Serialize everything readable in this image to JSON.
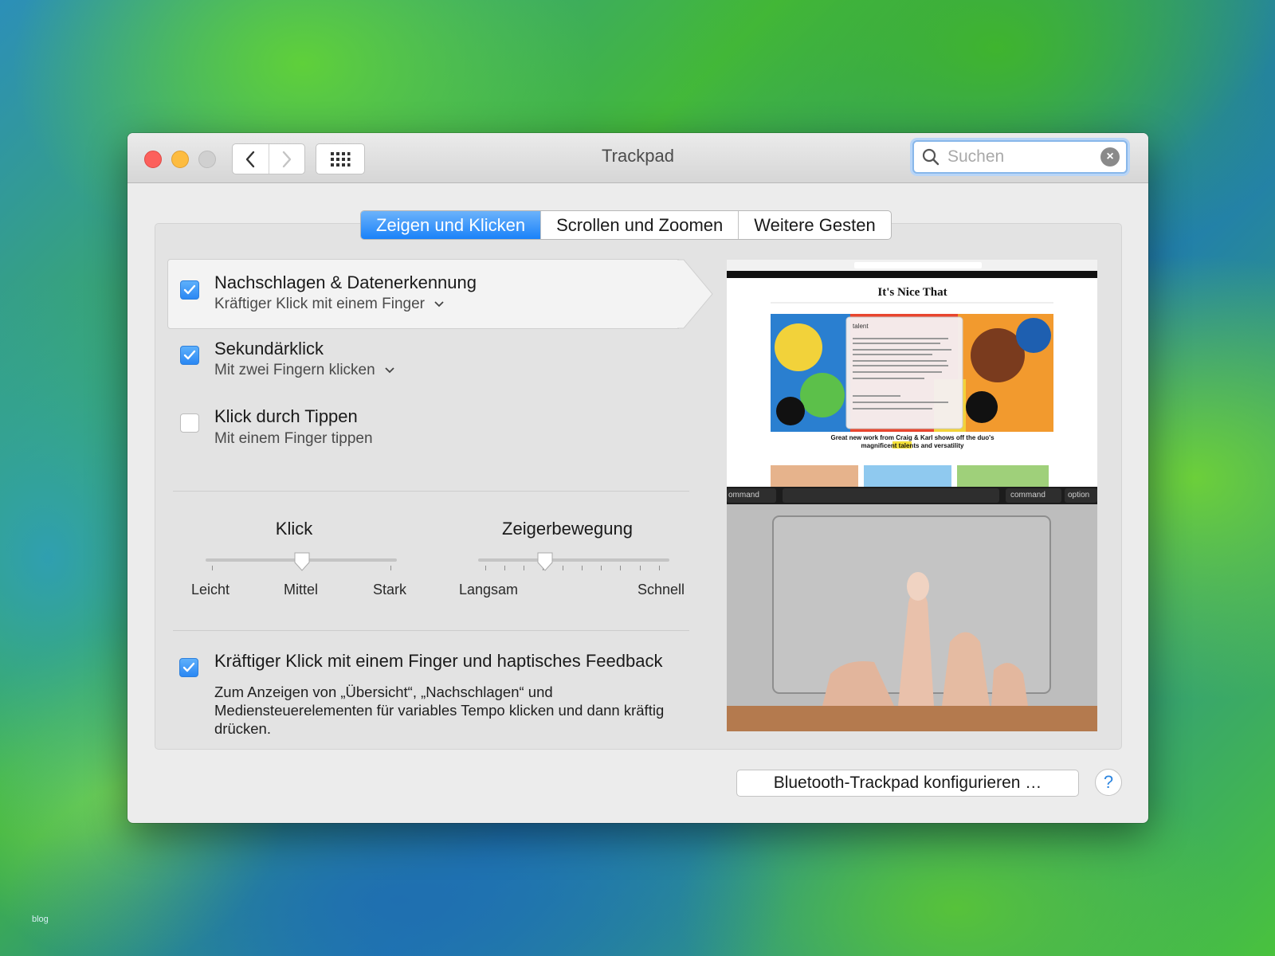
{
  "window": {
    "title": "Trackpad",
    "search_placeholder": "Suchen"
  },
  "tabs": [
    {
      "label": "Zeigen und Klicken",
      "active": true
    },
    {
      "label": "Scrollen und Zoomen",
      "active": false
    },
    {
      "label": "Weitere Gesten",
      "active": false
    }
  ],
  "options": [
    {
      "title": "Nachschlagen & Datenerkennung",
      "subtitle": "Kräftiger Klick mit einem Finger",
      "checked": true,
      "has_dropdown": true
    },
    {
      "title": "Sekundärklick",
      "subtitle": "Mit zwei Fingern klicken",
      "checked": true,
      "has_dropdown": true
    },
    {
      "title": "Klick durch Tippen",
      "subtitle": "Mit einem Finger tippen",
      "checked": false,
      "has_dropdown": false
    }
  ],
  "sliders": {
    "click": {
      "title": "Klick",
      "labels": [
        "Leicht",
        "Mittel",
        "Stark"
      ],
      "value_index": 1,
      "steps": 3
    },
    "tracking": {
      "title": "Zeigerbewegung",
      "min_label": "Langsam",
      "max_label": "Schnell",
      "value_fraction": 0.35,
      "steps": 10
    }
  },
  "force_click": {
    "title": "Kräftiger Klick mit einem Finger und haptisches Feedback",
    "description": "Zum Anzeigen von „Übersicht“, „Nachschlagen“ und Mediensteuerelementen für variables Tempo klicken und dann kräftig drücken.",
    "checked": true
  },
  "preview": {
    "site_name": "It's Nice That",
    "popup_word": "talent",
    "headline_line1": "Great new work from Craig & Karl shows off the duo's",
    "headline_line2": "magnificent talents and versatility",
    "keys": [
      "ommand",
      "command",
      "option"
    ]
  },
  "buttons": {
    "bluetooth": "Bluetooth-Trackpad konfigurieren …",
    "help": "?"
  },
  "watermark": "blog",
  "colors": {
    "accent": "#1a82f9",
    "window_bg": "#ececec"
  }
}
